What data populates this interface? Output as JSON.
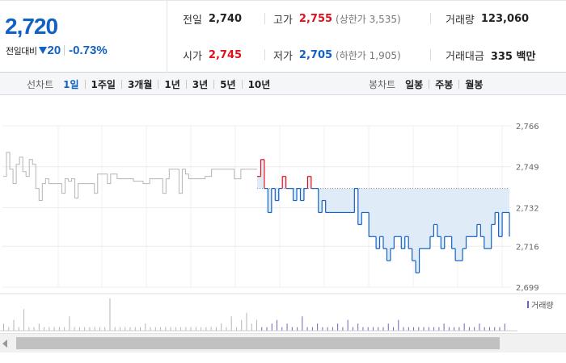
{
  "quote": {
    "price": "2,720",
    "change_label": "전일대비",
    "change_amount": "20",
    "change_pct": "-0.73%"
  },
  "stats": {
    "prev_close": {
      "label": "전일",
      "value": "2,740"
    },
    "high": {
      "label": "고가",
      "value": "2,755",
      "sub": "(상한가 3,535)"
    },
    "volume": {
      "label": "거래량",
      "value": "123,060"
    },
    "open": {
      "label": "시가",
      "value": "2,745"
    },
    "low": {
      "label": "저가",
      "value": "2,705",
      "sub": "(하한가 1,905)"
    },
    "trade_value": {
      "label": "거래대금",
      "value": "335 백만"
    }
  },
  "line_tabs": {
    "title": "선차트",
    "items": [
      "1일",
      "1주일",
      "3개월",
      "1년",
      "3년",
      "5년",
      "10년"
    ],
    "active": "1일"
  },
  "candle_tabs": {
    "title": "봉차트",
    "items": [
      "일봉",
      "주봉",
      "월봉"
    ]
  },
  "colors": {
    "up": "#e0111c",
    "down": "#1261c4",
    "prev_line": "#b5b5b5",
    "fill": "#dde9f7",
    "volume": "#7a5fb8"
  },
  "chart_data": {
    "type": "line",
    "y_ticks": [
      "2,766",
      "2,749",
      "2,732",
      "2,716",
      "2,699"
    ],
    "ylim": [
      2699,
      2766
    ],
    "reference_price": 2740,
    "legend": "거래량",
    "prev_day_series": [
      2745,
      2755,
      2748,
      2742,
      2750,
      2753,
      2747,
      2745,
      2752,
      2750,
      2740,
      2735,
      2742,
      2744,
      2742,
      2742,
      2742,
      2742,
      2738,
      2744,
      2743,
      2744,
      2736,
      2742,
      2742,
      2742,
      2742,
      2742,
      2738,
      2746,
      2746,
      2746,
      2742,
      2746,
      2746,
      2744,
      2744,
      2744,
      2744,
      2744,
      2743,
      2743,
      2743,
      2742,
      2742,
      2744,
      2744,
      2744,
      2744,
      2738,
      2744,
      2748,
      2748,
      2748,
      2738,
      2748,
      2746,
      2744,
      2744,
      2744,
      2744,
      2744,
      2745,
      2745,
      2748,
      2748,
      2748,
      2748,
      2748,
      2748,
      2748,
      2744,
      2744,
      2748,
      2748,
      2748,
      2748,
      2748,
      2748
    ],
    "today_series": [
      2745,
      2752,
      2740,
      2730,
      2740,
      2735,
      2740,
      2745,
      2740,
      2740,
      2735,
      2740,
      2735,
      2740,
      2745,
      2740,
      2740,
      2730,
      2735,
      2730,
      2730,
      2730,
      2730,
      2730,
      2730,
      2730,
      2730,
      2740,
      2725,
      2730,
      2730,
      2720,
      2720,
      2715,
      2720,
      2715,
      2710,
      2715,
      2720,
      2720,
      2715,
      2720,
      2715,
      2710,
      2705,
      2715,
      2715,
      2715,
      2720,
      2725,
      2720,
      2715,
      2720,
      2720,
      2715,
      2710,
      2710,
      2715,
      2720,
      2720,
      2720,
      2725,
      2720,
      2715,
      2715,
      2725,
      2730,
      2720,
      2730,
      2730,
      2720
    ],
    "volume_series": [
      2,
      1,
      3,
      1,
      6,
      1,
      1,
      2,
      1,
      1,
      1,
      1,
      1,
      4,
      1,
      1,
      1,
      1,
      1,
      1,
      1,
      9,
      1,
      1,
      1,
      1,
      1,
      1,
      2,
      1,
      1,
      1,
      1,
      1,
      1,
      1,
      1,
      1,
      1,
      1,
      1,
      1,
      1,
      2,
      1,
      4,
      1,
      3,
      5,
      2,
      3,
      1,
      1,
      2,
      3,
      1,
      2,
      1,
      1,
      4,
      1,
      1,
      2,
      1,
      1,
      1,
      2,
      1,
      3,
      1,
      2,
      1,
      1,
      1,
      1,
      1,
      2,
      1,
      3,
      1,
      1,
      1,
      1,
      1,
      1,
      1,
      1,
      2,
      1,
      1,
      1,
      2,
      1,
      1,
      2,
      1,
      1,
      1,
      1,
      2
    ]
  }
}
